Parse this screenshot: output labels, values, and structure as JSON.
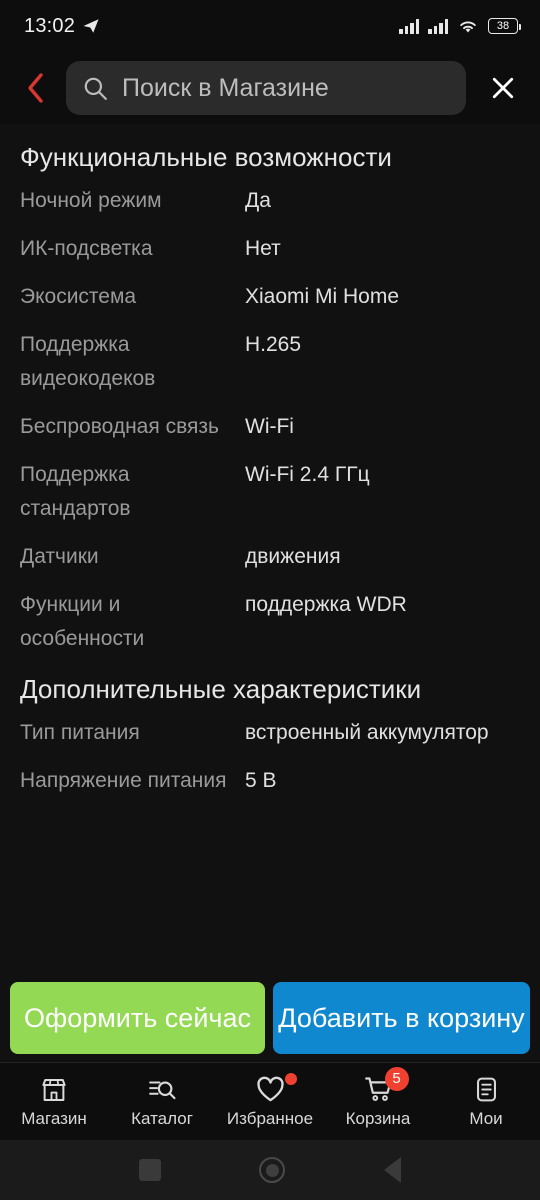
{
  "statusbar": {
    "time": "13:02",
    "telegram_icon": "telegram-plane-icon",
    "signal_icon": "cellular-signal-icon",
    "wifi_icon": "wifi-icon",
    "battery_level": "38"
  },
  "header": {
    "back_icon": "chevron-left-icon",
    "back_color": "#d8372f",
    "search_icon": "search-icon",
    "search_value": "",
    "search_placeholder": "Поиск в Магазине",
    "close_icon": "close-icon"
  },
  "sections": [
    {
      "title": "Функциональные возможности",
      "rows": [
        {
          "label": "Ночной режим",
          "value": "Да"
        },
        {
          "label": "ИК-подсветка",
          "value": "Нет"
        },
        {
          "label": "Экосистема",
          "value": "Xiaomi Mi Home"
        },
        {
          "label": "Поддержка видеокодеков",
          "value": "H.265"
        },
        {
          "label": "Беспроводная связь",
          "value": "Wi-Fi"
        },
        {
          "label": "Поддержка стандартов",
          "value": "Wi-Fi 2.4 ГГц"
        },
        {
          "label": "Датчики",
          "value": "движения"
        },
        {
          "label": "Функции и особенности",
          "value": "поддержка WDR"
        }
      ]
    },
    {
      "title": "Дополнительные характеристики",
      "rows": [
        {
          "label": "Тип питания",
          "value": "встроенный аккумулятор"
        },
        {
          "label": "Напряжение питания",
          "value": "5 В"
        }
      ]
    }
  ],
  "cta": {
    "buy_label": "Оформить сейчас",
    "buy_color": "#93d953",
    "cart_label": "Добавить в корзину",
    "cart_color": "#1088d0"
  },
  "tabbar": {
    "items": [
      {
        "label": "Магазин",
        "icon": "storefront-icon"
      },
      {
        "label": "Каталог",
        "icon": "catalog-search-icon"
      },
      {
        "label": "Избранное",
        "icon": "heart-icon",
        "dot": true
      },
      {
        "label": "Корзина",
        "icon": "cart-icon",
        "badge": "5"
      },
      {
        "label": "Мои",
        "icon": "document-list-icon"
      }
    ],
    "badge_color": "#f0402f"
  },
  "androidnav": {
    "recents_icon": "recents-square-icon",
    "home_icon": "home-circle-icon",
    "back_icon": "back-triangle-icon"
  }
}
